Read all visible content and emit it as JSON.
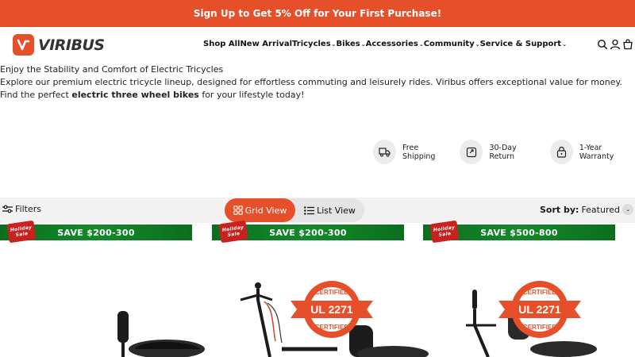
{
  "promo": {
    "text": "Sign Up to Get 5% Off for Your First Purchase!"
  },
  "brand": {
    "name": "VIRIBUS",
    "accent": "#e5502a"
  },
  "nav": {
    "items": [
      {
        "label": "Shop All",
        "dropdown": false
      },
      {
        "label": "New Arrival",
        "dropdown": false
      },
      {
        "label": "Tricycles",
        "dropdown": true
      },
      {
        "label": "Bikes",
        "dropdown": true
      },
      {
        "label": "Accessories",
        "dropdown": true
      },
      {
        "label": "Community",
        "dropdown": true
      },
      {
        "label": "Service & Support",
        "dropdown": true
      }
    ],
    "icons": [
      "search-icon",
      "account-icon",
      "cart-icon"
    ]
  },
  "intro": {
    "heading": "Enjoy the Stability and Comfort of Electric Tricycles",
    "body_before": "Explore our premium electric tricycle lineup, designed for effortless commuting and leisurely rides. Viribus offers exceptional value for money. Find the perfect ",
    "body_bold": "electric three wheel bikes",
    "body_after": " for your lifestyle today!"
  },
  "features": [
    {
      "label": "Free Shipping",
      "icon": "truck-icon"
    },
    {
      "label": "30-Day Return",
      "icon": "return-icon"
    },
    {
      "label": "1-Year Warranty",
      "icon": "lock-icon"
    }
  ],
  "toolbar": {
    "filters_label": "Filters",
    "grid_view_label": "Grid View",
    "list_view_label": "List View",
    "sort_label": "Sort by:",
    "sort_value": "Featured"
  },
  "products": [
    {
      "banner": "SAVE $200-300",
      "sale_badge": "Holiday Sale",
      "certified": false
    },
    {
      "banner": "SAVE $200-300",
      "sale_badge": "Holiday Sale",
      "certified": true,
      "cert_text": "UL 2271",
      "cert_top": "CERTIFIED",
      "cert_bottom": "CERTIFIED"
    },
    {
      "banner": "SAVE $500-800",
      "sale_badge": "Holiday Sale",
      "certified": true,
      "cert_text": "UL 2271",
      "cert_top": "CERTIFIED",
      "cert_bottom": "CERTIFIED"
    }
  ]
}
